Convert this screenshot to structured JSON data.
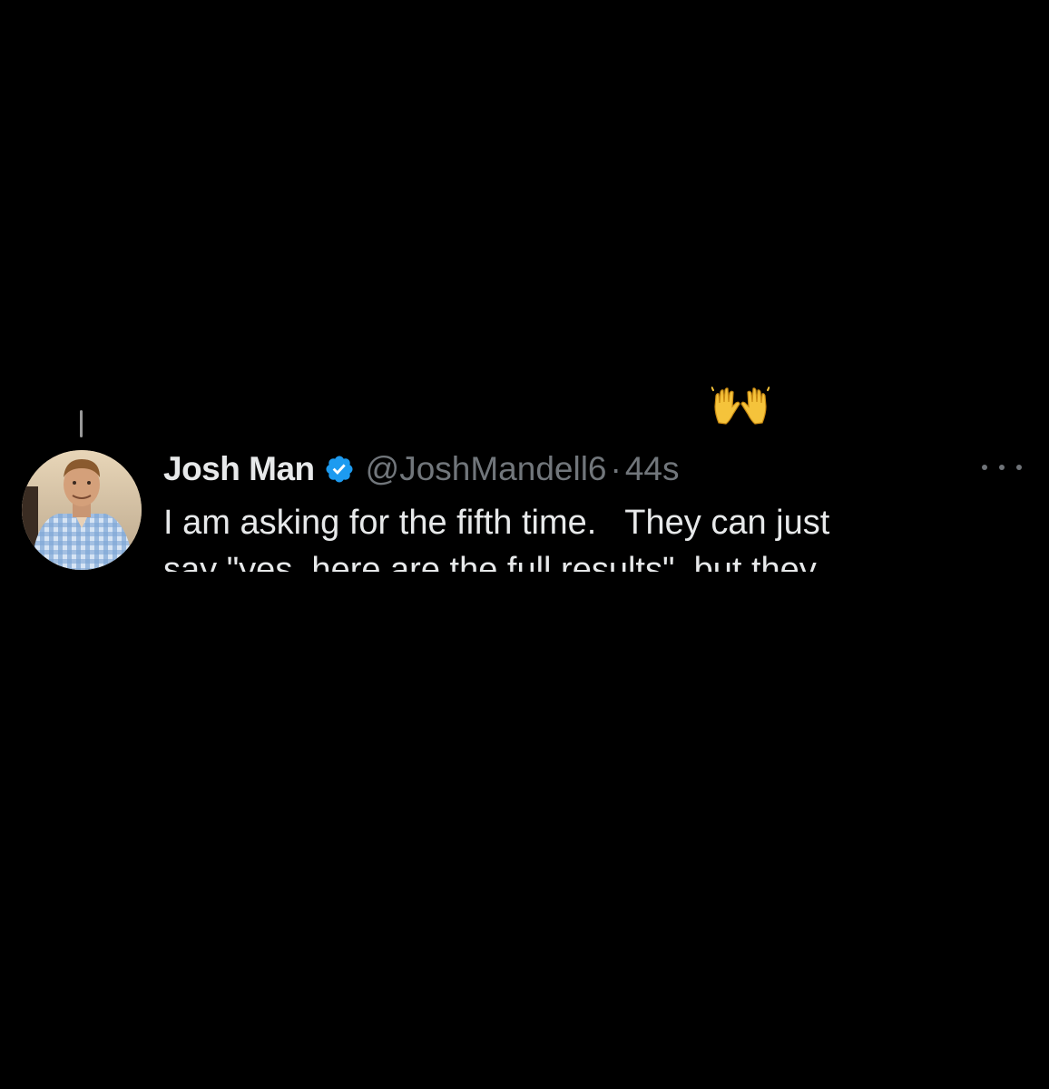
{
  "tweet": {
    "reaction_emoji": "🙌",
    "author_name": "Josh Man",
    "handle": "@JoshMandell6",
    "separator": "·",
    "time_ago": "44s",
    "text_line_1": "I am asking for the fifth time.   They can just",
    "text_line_2": "say \"yes, here are the full results\", but they"
  },
  "colors": {
    "background": "#000000",
    "text_primary": "#e7e9ea",
    "text_secondary": "#71767b",
    "verified_blue": "#1d9bf0"
  },
  "icons": [
    "raising-hands-icon",
    "verified-badge-icon",
    "more-options-icon"
  ]
}
